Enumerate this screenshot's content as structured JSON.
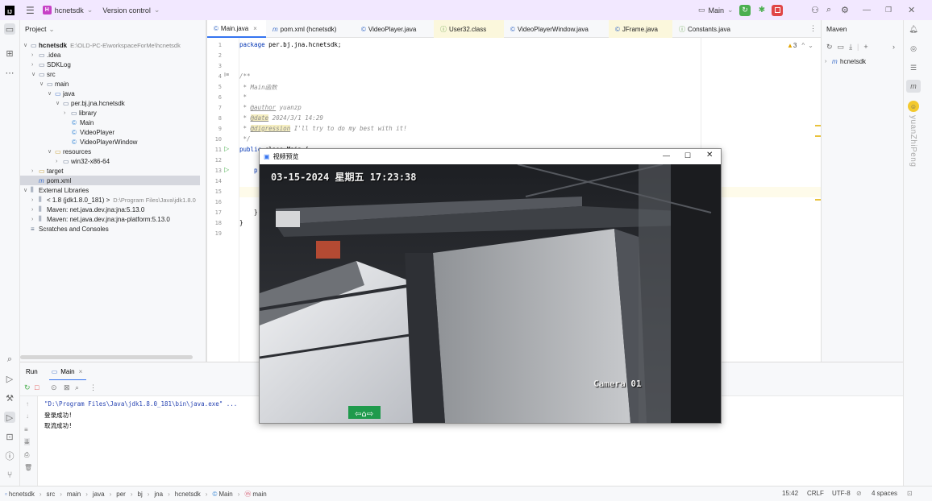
{
  "titlebar": {
    "project_badge": "H",
    "project_name": "hcnetsdk",
    "vcs_label": "Version control",
    "run_config": "Main"
  },
  "project_pane": {
    "header": "Project",
    "tree": [
      {
        "label": "hcnetsdk",
        "path": "E:\\OLD-PC-E\\workspaceForMe\\hcnetsdk"
      },
      {
        "label": ".idea"
      },
      {
        "label": "SDKLog"
      },
      {
        "label": "src"
      },
      {
        "label": "main"
      },
      {
        "label": "java"
      },
      {
        "label": "per.bj.jna.hcnetsdk"
      },
      {
        "label": "library"
      },
      {
        "label": "Main"
      },
      {
        "label": "VideoPlayer"
      },
      {
        "label": "VideoPlayerWindow"
      },
      {
        "label": "resources"
      },
      {
        "label": "win32-x86-64"
      },
      {
        "label": "target"
      },
      {
        "label": "pom.xml"
      },
      {
        "label": "External Libraries"
      },
      {
        "label": "< 1.8 (jdk1.8.0_181) >",
        "path": "D:\\Program Files\\Java\\jdk1.8.0"
      },
      {
        "label": "Maven: net.java.dev.jna:jna:5.13.0"
      },
      {
        "label": "Maven: net.java.dev.jna:jna-platform:5.13.0"
      },
      {
        "label": "Scratches and Consoles"
      }
    ]
  },
  "editor": {
    "tabs": [
      "Main.java",
      "pom.xml (hcnetsdk)",
      "VideoPlayer.java",
      "User32.class",
      "VideoPlayerWindow.java",
      "JFrame.java",
      "Constants.java"
    ],
    "warnings": "3",
    "line_numbers": [
      "1",
      "2",
      "3",
      "4",
      "5",
      "6",
      "7",
      "8",
      "9",
      "10",
      "11",
      "12",
      "13",
      "14",
      "15",
      "16",
      "17",
      "18",
      "19"
    ],
    "code": {
      "l1_kw": "package",
      "l1_rest": " per.bj.jna.hcnetsdk;",
      "l4": "/**",
      "l5": " * Main函数",
      "l6": " *",
      "l7_pre": " * ",
      "l7_tag": "@author",
      "l7_rest": " yuanzp",
      "l8_pre": " * ",
      "l8_tag": "@date",
      "l8_rest": " 2024/3/1 14:29",
      "l9_pre": " * ",
      "l9_tag": "@digression",
      "l9_rest": " I'll try to do my best with it!",
      "l10": " */",
      "l11_kw": "public",
      "l11_rest": " class Main {",
      "l13": "    p",
      "l17": "    }",
      "l18": "}"
    }
  },
  "maven": {
    "header": "Maven",
    "item": "hcnetsdk"
  },
  "right_strip": {
    "vertical_text": "yuanZhiPeng"
  },
  "run": {
    "tab_run": "Run",
    "tab_main": "Main",
    "console_lines": [
      "\"D:\\Program Files\\Java\\jdk1.8.0_181\\bin\\java.exe\" ...",
      "登录成功!",
      "取流成功!"
    ]
  },
  "video_window": {
    "title": "视频预览",
    "osd_datetime": "03-15-2024 星期五 17:23:38",
    "osd_camera": "Camera 01"
  },
  "status": {
    "breadcrumb": [
      "hcnetsdk",
      "src",
      "main",
      "java",
      "per",
      "bj",
      "jna",
      "hcnetsdk",
      "Main",
      "main"
    ],
    "position": "15:42",
    "line_sep": "CRLF",
    "encoding": "UTF-8",
    "indent": "4 spaces"
  },
  "colors": {
    "accent": "#3574f0",
    "title_bg": "#f2e8ff",
    "run_green": "#4caf50",
    "stop_red": "#e04646"
  }
}
